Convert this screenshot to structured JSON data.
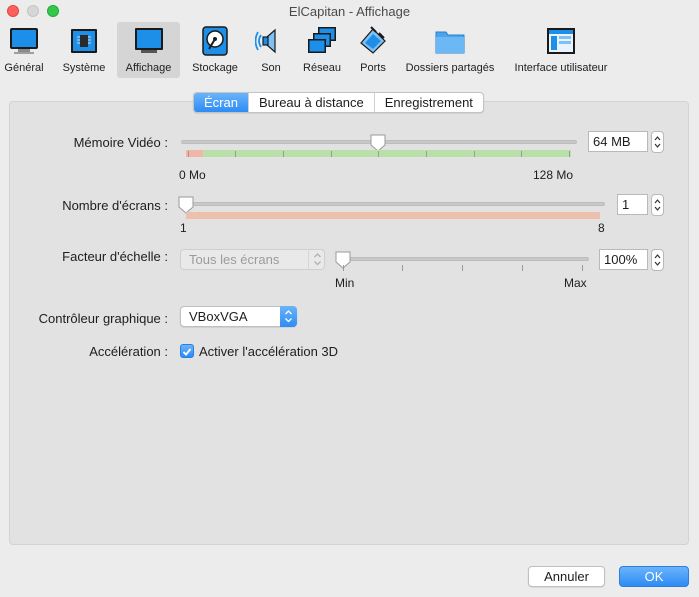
{
  "window": {
    "title": "ElCapitan - Affichage"
  },
  "toolbar": {
    "items": [
      {
        "label": "Général",
        "icon": "general-icon"
      },
      {
        "label": "Système",
        "icon": "system-chip-icon"
      },
      {
        "label": "Affichage",
        "icon": "display-monitor-icon",
        "active": true
      },
      {
        "label": "Stockage",
        "icon": "storage-disk-icon"
      },
      {
        "label": "Son",
        "icon": "speaker-icon"
      },
      {
        "label": "Réseau",
        "icon": "network-icon"
      },
      {
        "label": "Ports",
        "icon": "ports-plug-icon"
      },
      {
        "label": "Dossiers partagés",
        "icon": "shared-folder-icon"
      },
      {
        "label": "Interface utilisateur",
        "icon": "user-interface-icon"
      }
    ]
  },
  "tabs": [
    {
      "label": "Écran",
      "selected": true
    },
    {
      "label": "Bureau à distance",
      "selected": false
    },
    {
      "label": "Enregistrement",
      "selected": false
    }
  ],
  "video_memory": {
    "label": "Mémoire Vidéo :",
    "value": "64 MB",
    "fraction": 0.5,
    "min_label": "0 Mo",
    "max_label": "128 Mo"
  },
  "screens": {
    "label": "Nombre d'écrans :",
    "value": "1",
    "fraction": 0,
    "min_label": "1",
    "max_label": "8"
  },
  "scale": {
    "label": "Facteur d'échelle :",
    "combo_value": "Tous les écrans",
    "value": "100%",
    "fraction": 0,
    "min_label": "Min",
    "max_label": "Max"
  },
  "controller": {
    "label": "Contrôleur graphique :",
    "value": "VBoxVGA"
  },
  "acceleration": {
    "label": "Accélération :",
    "checkbox_label": "Activer l'accélération 3D",
    "checked": true
  },
  "buttons": {
    "cancel": "Annuler",
    "ok": "OK"
  },
  "colors": {
    "accent": "#2d8cf4",
    "bar_green": "#b8e0a8",
    "bar_red": "#f0b6a8",
    "bar_salmon": "#edc0ad"
  }
}
